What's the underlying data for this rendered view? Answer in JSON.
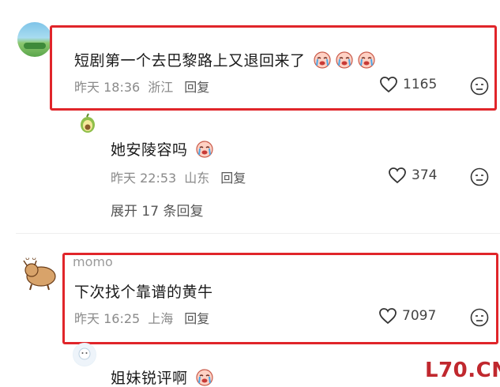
{
  "comments": [
    {
      "text": "短剧第一个去巴黎路上又退回来了",
      "time": "昨天 18:36",
      "location": "浙江",
      "reply_label": "回复",
      "likes": "1165",
      "emoji_count": 3
    },
    {
      "text": "她安陵容吗",
      "time": "昨天 22:53",
      "location": "山东",
      "reply_label": "回复",
      "likes": "374",
      "emoji_count": 1
    },
    {
      "username": "momo",
      "text": "下次找个靠谱的黄牛",
      "time": "昨天 16:25",
      "location": "上海",
      "reply_label": "回复",
      "likes": "7097"
    },
    {
      "text": "姐妹锐评啊",
      "emoji_count": 1
    }
  ],
  "expand_replies": "展开 17 条回复",
  "watermark": "L70.CN",
  "colors": {
    "highlight": "#e0252a",
    "watermark": "#c0282e"
  }
}
